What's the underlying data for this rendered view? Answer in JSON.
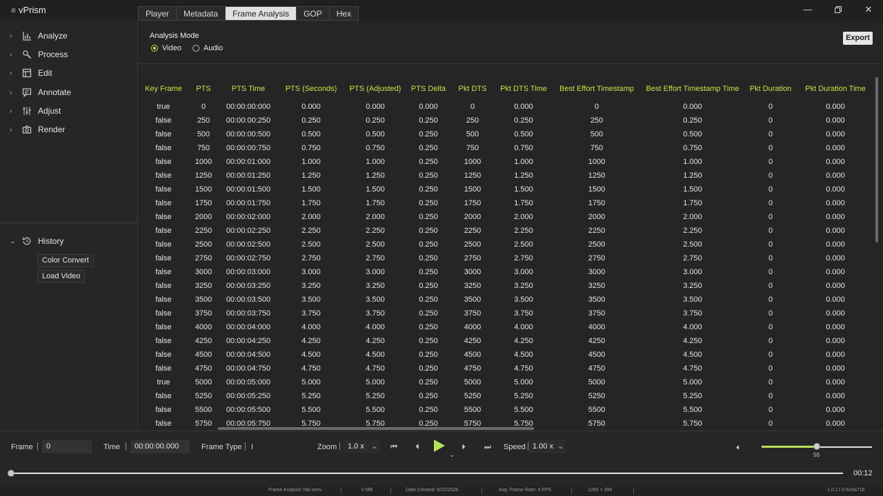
{
  "app": {
    "title": "vPrism"
  },
  "tabs": [
    "Player",
    "Metadata",
    "Frame Analysis",
    "GOP",
    "Hex"
  ],
  "active_tab": "Frame Analysis",
  "sidebar": {
    "items": [
      {
        "label": "Analyze",
        "icon": "bar-chart-icon"
      },
      {
        "label": "Process",
        "icon": "wrench-icon"
      },
      {
        "label": "Edit",
        "icon": "layout-icon"
      },
      {
        "label": "Annotate",
        "icon": "message-icon"
      },
      {
        "label": "Adjust",
        "icon": "sliders-icon"
      },
      {
        "label": "Render",
        "icon": "camera-icon"
      }
    ],
    "history": {
      "label": "History",
      "icon": "history-icon",
      "entries": [
        "Color Convert",
        "Load Video"
      ]
    }
  },
  "analysis": {
    "mode_label": "Analysis Mode",
    "modes": [
      "Video",
      "Audio"
    ],
    "selected_mode": "Video",
    "export_label": "Export",
    "columns": [
      "Key Frame",
      "PTS",
      "PTS Time",
      "PTS (Seconds)",
      "PTS (Adjusted)",
      "PTS Delta",
      "Pkt DTS",
      "Pkt DTS Time",
      "Best Effort Timestamp",
      "Best Effort Timestamp Time",
      "Pkt Duration",
      "Pkt Duration Time"
    ],
    "rows": [
      [
        "true",
        "0",
        "00:00:00:000",
        "0.000",
        "0.000",
        "0.000",
        "0",
        "0.000",
        "0",
        "0.000",
        "0",
        "0.000"
      ],
      [
        "false",
        "250",
        "00:00:00:250",
        "0.250",
        "0.250",
        "0.250",
        "250",
        "0.250",
        "250",
        "0.250",
        "0",
        "0.000"
      ],
      [
        "false",
        "500",
        "00:00:00:500",
        "0.500",
        "0.500",
        "0.250",
        "500",
        "0.500",
        "500",
        "0.500",
        "0",
        "0.000"
      ],
      [
        "false",
        "750",
        "00:00:00:750",
        "0.750",
        "0.750",
        "0.250",
        "750",
        "0.750",
        "750",
        "0.750",
        "0",
        "0.000"
      ],
      [
        "false",
        "1000",
        "00:00:01:000",
        "1.000",
        "1.000",
        "0.250",
        "1000",
        "1.000",
        "1000",
        "1.000",
        "0",
        "0.000"
      ],
      [
        "false",
        "1250",
        "00:00:01:250",
        "1.250",
        "1.250",
        "0.250",
        "1250",
        "1.250",
        "1250",
        "1.250",
        "0",
        "0.000"
      ],
      [
        "false",
        "1500",
        "00:00:01:500",
        "1.500",
        "1.500",
        "0.250",
        "1500",
        "1.500",
        "1500",
        "1.500",
        "0",
        "0.000"
      ],
      [
        "false",
        "1750",
        "00:00:01:750",
        "1.750",
        "1.750",
        "0.250",
        "1750",
        "1.750",
        "1750",
        "1.750",
        "0",
        "0.000"
      ],
      [
        "false",
        "2000",
        "00:00:02:000",
        "2.000",
        "2.000",
        "0.250",
        "2000",
        "2.000",
        "2000",
        "2.000",
        "0",
        "0.000"
      ],
      [
        "false",
        "2250",
        "00:00:02:250",
        "2.250",
        "2.250",
        "0.250",
        "2250",
        "2.250",
        "2250",
        "2.250",
        "0",
        "0.000"
      ],
      [
        "false",
        "2500",
        "00:00:02:500",
        "2.500",
        "2.500",
        "0.250",
        "2500",
        "2.500",
        "2500",
        "2.500",
        "0",
        "0.000"
      ],
      [
        "false",
        "2750",
        "00:00:02:750",
        "2.750",
        "2.750",
        "0.250",
        "2750",
        "2.750",
        "2750",
        "2.750",
        "0",
        "0.000"
      ],
      [
        "false",
        "3000",
        "00:00:03:000",
        "3.000",
        "3.000",
        "0.250",
        "3000",
        "3.000",
        "3000",
        "3.000",
        "0",
        "0.000"
      ],
      [
        "false",
        "3250",
        "00:00:03:250",
        "3.250",
        "3.250",
        "0.250",
        "3250",
        "3.250",
        "3250",
        "3.250",
        "0",
        "0.000"
      ],
      [
        "false",
        "3500",
        "00:00:03:500",
        "3.500",
        "3.500",
        "0.250",
        "3500",
        "3.500",
        "3500",
        "3.500",
        "0",
        "0.000"
      ],
      [
        "false",
        "3750",
        "00:00:03:750",
        "3.750",
        "3.750",
        "0.250",
        "3750",
        "3.750",
        "3750",
        "3.750",
        "0",
        "0.000"
      ],
      [
        "false",
        "4000",
        "00:00:04:000",
        "4.000",
        "4.000",
        "0.250",
        "4000",
        "4.000",
        "4000",
        "4.000",
        "0",
        "0.000"
      ],
      [
        "false",
        "4250",
        "00:00:04:250",
        "4.250",
        "4.250",
        "0.250",
        "4250",
        "4.250",
        "4250",
        "4.250",
        "0",
        "0.000"
      ],
      [
        "false",
        "4500",
        "00:00:04:500",
        "4.500",
        "4.500",
        "0.250",
        "4500",
        "4.500",
        "4500",
        "4.500",
        "0",
        "0.000"
      ],
      [
        "false",
        "4750",
        "00:00:04:750",
        "4.750",
        "4.750",
        "0.250",
        "4750",
        "4.750",
        "4750",
        "4.750",
        "0",
        "0.000"
      ],
      [
        "true",
        "5000",
        "00:00:05:000",
        "5.000",
        "5.000",
        "0.250",
        "5000",
        "5.000",
        "5000",
        "5.000",
        "0",
        "0.000"
      ],
      [
        "false",
        "5250",
        "00:00:05:250",
        "5.250",
        "5.250",
        "0.250",
        "5250",
        "5.250",
        "5250",
        "5.250",
        "0",
        "0.000"
      ],
      [
        "false",
        "5500",
        "00:00:05:500",
        "5.500",
        "5.500",
        "0.250",
        "5500",
        "5.500",
        "5500",
        "5.500",
        "0",
        "0.000"
      ],
      [
        "false",
        "5750",
        "00:00:05:750",
        "5.750",
        "5.750",
        "0.250",
        "5750",
        "5.750",
        "5750",
        "5.750",
        "0",
        "0.000"
      ]
    ]
  },
  "controls": {
    "frame_label": "Frame",
    "frame_value": "0",
    "time_label": "Time",
    "time_value": "00:00:00.000",
    "frame_type_label": "Frame Type",
    "frame_type_value": "I",
    "zoom_label": "Zoom",
    "zoom_value": "1.0 x",
    "speed_label": "Speed",
    "speed_value": "1.00 x",
    "volume": 50,
    "volume_label": "50",
    "seek_position": 0,
    "time_right": "00:12"
  },
  "status": {
    "file": "Frame Analysis Tab.wmv",
    "size": "0 MB",
    "date_created": "Date Created: 6/22/2026",
    "frame_rate": "Avg. Frame Rate: 4 FPS",
    "resolution": "1280 × 396",
    "version": "1.0.17.0-5c9a71b"
  },
  "colors": {
    "accent": "#b9e25b",
    "header_text": "#c8e34a",
    "background": "#252525"
  }
}
